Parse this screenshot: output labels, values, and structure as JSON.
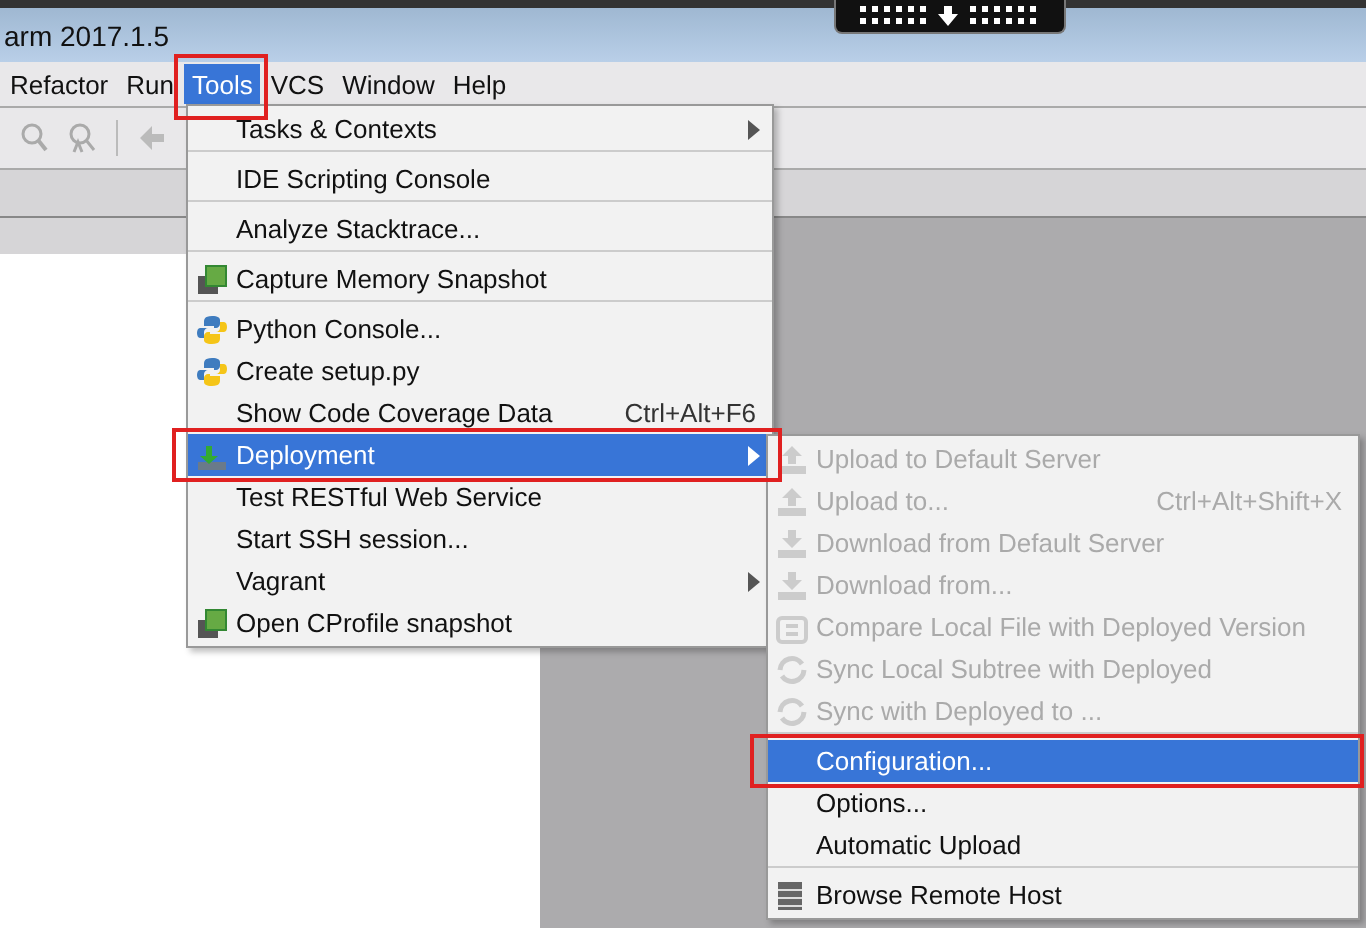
{
  "window": {
    "title": "arm 2017.1.5"
  },
  "menu_bar": [
    {
      "label": "Refactor",
      "selected": false,
      "highlighted": false
    },
    {
      "label": "Run",
      "selected": false,
      "highlighted": false
    },
    {
      "label": "Tools",
      "selected": true,
      "highlighted": true
    },
    {
      "label": "VCS",
      "selected": false,
      "highlighted": false
    },
    {
      "label": "Window",
      "selected": false,
      "highlighted": false
    },
    {
      "label": "Help",
      "selected": false,
      "highlighted": false
    }
  ],
  "tools_menu": [
    {
      "label": "Tasks & Contexts",
      "kind": "plain",
      "submenu": true,
      "separator_after": true,
      "selected": false,
      "highlighted": false
    },
    {
      "label": "IDE Scripting Console",
      "kind": "plain",
      "submenu": false,
      "separator_after": true,
      "selected": false,
      "highlighted": false
    },
    {
      "label": "Analyze Stacktrace...",
      "kind": "plain",
      "submenu": false,
      "separator_after": true,
      "selected": false,
      "highlighted": false
    },
    {
      "label": "Capture Memory Snapshot",
      "kind": "chip",
      "submenu": false,
      "separator_after": true,
      "selected": false,
      "highlighted": false
    },
    {
      "label": "Python Console...",
      "kind": "python",
      "submenu": false,
      "separator_after": false,
      "selected": false,
      "highlighted": false
    },
    {
      "label": "Create setup.py",
      "kind": "python",
      "submenu": false,
      "separator_after": false,
      "selected": false,
      "highlighted": false
    },
    {
      "label": "Show Code Coverage Data",
      "shortcut": "Ctrl+Alt+F6",
      "kind": "plain",
      "submenu": false,
      "separator_after": false,
      "selected": false,
      "highlighted": false
    },
    {
      "label": "Deployment",
      "kind": "deploy",
      "submenu": true,
      "separator_after": false,
      "selected": true,
      "highlighted": true
    },
    {
      "label": "Test RESTful Web Service",
      "kind": "plain",
      "submenu": false,
      "separator_after": false,
      "selected": false,
      "highlighted": false
    },
    {
      "label": "Start SSH session...",
      "kind": "plain",
      "submenu": false,
      "separator_after": false,
      "selected": false,
      "highlighted": false
    },
    {
      "label": "Vagrant",
      "kind": "plain",
      "submenu": true,
      "separator_after": false,
      "selected": false,
      "highlighted": false
    },
    {
      "label": "Open CProfile snapshot",
      "kind": "chip",
      "submenu": false,
      "separator_after": false,
      "selected": false,
      "highlighted": false
    }
  ],
  "deployment_menu": [
    {
      "label": "Upload to Default Server",
      "kind": "upload",
      "disabled": true,
      "separator_after": false,
      "selected": false,
      "highlighted": false
    },
    {
      "label": "Upload to...",
      "shortcut": "Ctrl+Alt+Shift+X",
      "kind": "upload",
      "disabled": true,
      "separator_after": false,
      "selected": false,
      "highlighted": false
    },
    {
      "label": "Download from Default Server",
      "kind": "download",
      "disabled": true,
      "separator_after": false,
      "selected": false,
      "highlighted": false
    },
    {
      "label": "Download from...",
      "kind": "download",
      "disabled": true,
      "separator_after": false,
      "selected": false,
      "highlighted": false
    },
    {
      "label": "Compare Local File with Deployed Version",
      "kind": "compare",
      "disabled": true,
      "separator_after": false,
      "selected": false,
      "highlighted": false
    },
    {
      "label": "Sync Local Subtree with Deployed",
      "kind": "sync",
      "disabled": true,
      "separator_after": false,
      "selected": false,
      "highlighted": false
    },
    {
      "label": "Sync with Deployed to ...",
      "kind": "sync",
      "disabled": true,
      "separator_after": true,
      "selected": false,
      "highlighted": false
    },
    {
      "label": "Configuration...",
      "kind": "plain",
      "disabled": false,
      "separator_after": false,
      "selected": true,
      "highlighted": true
    },
    {
      "label": "Options...",
      "kind": "plain",
      "disabled": false,
      "separator_after": false,
      "selected": false,
      "highlighted": false
    },
    {
      "label": "Automatic Upload",
      "kind": "plain",
      "disabled": false,
      "separator_after": true,
      "selected": false,
      "highlighted": false
    },
    {
      "label": "Browse Remote Host",
      "kind": "server",
      "disabled": false,
      "separator_after": false,
      "selected": false,
      "highlighted": false
    }
  ]
}
